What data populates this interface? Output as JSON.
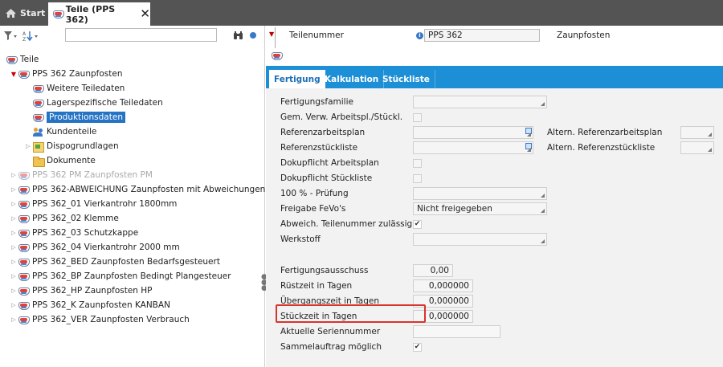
{
  "tabs": {
    "start_label": "Start",
    "active_label": "Teile (PPS 362)",
    "close_glyph": "✕"
  },
  "left_toolbar": {
    "search_value": ""
  },
  "tree": {
    "root_label": "Teile",
    "selected_part": "PPS 362  Zaunpfosten",
    "children": [
      {
        "label": "Weitere Teiledaten",
        "icon": "part-icon"
      },
      {
        "label": "Lagerspezifische Teiledaten",
        "icon": "part-icon"
      },
      {
        "label": "Produktionsdaten",
        "icon": "part-icon",
        "selected": true
      },
      {
        "label": "Kundenteile",
        "icon": "people-icon"
      },
      {
        "label": "Dispogrundlagen",
        "icon": "dispo-icon"
      },
      {
        "label": "Dokumente",
        "icon": "folder-icon"
      }
    ],
    "siblings": [
      {
        "label": "PPS 362 PM  Zaunpfosten PM",
        "disabled": true
      },
      {
        "label": "PPS 362-ABWEICHUNG  Zaunpfosten mit Abweichungen"
      },
      {
        "label": "PPS 362_01  Vierkantrohr 1800mm"
      },
      {
        "label": "PPS 362_02  Klemme"
      },
      {
        "label": "PPS 362_03  Schutzkappe"
      },
      {
        "label": "PPS 362_04  Vierkantrohr 2000 mm"
      },
      {
        "label": "PPS 362_BED  Zaunpfosten Bedarfsgesteuert"
      },
      {
        "label": "PPS 362_BP  Zaunpfosten Bedingt Plangesteuer"
      },
      {
        "label": "PPS 362_HP  Zaunpfosten HP"
      },
      {
        "label": "PPS 362_K  Zaunpfosten KANBAN"
      },
      {
        "label": "PPS 362_VER  Zaunpfosten Verbrauch"
      }
    ]
  },
  "header": {
    "label": "Teilenummer",
    "info_glyph": "i",
    "value": "PPS 362",
    "description": "Zaunpfosten"
  },
  "right_tabs": [
    "Fertigung",
    "Kalkulation",
    "Stückliste"
  ],
  "form": {
    "fertigungsfamilie": {
      "label": "Fertigungsfamilie",
      "value": ""
    },
    "gem_verw": {
      "label": "Gem. Verw. Arbeitspl./Stückl.",
      "checked": false
    },
    "referenzarbeitsplan": {
      "label": "Referenzarbeitsplan",
      "value": ""
    },
    "altern_referenzarbeitsplan": {
      "label": "Altern. Referenzarbeitsplan",
      "value": ""
    },
    "referenzstueckliste": {
      "label": "Referenzstückliste",
      "value": ""
    },
    "altern_referenzstueckliste": {
      "label": "Altern. Referenzstückliste",
      "value": ""
    },
    "dokupflicht_arbeitsplan": {
      "label": "Dokupflicht Arbeitsplan",
      "checked": false
    },
    "dokupflicht_stueckliste": {
      "label": "Dokupflicht Stückliste",
      "checked": false
    },
    "pruefung": {
      "label": "100 % - Prüfung",
      "value": ""
    },
    "freigabe": {
      "label": "Freigabe FeVo's",
      "value": "Nicht freigegeben"
    },
    "abweich": {
      "label": "Abweich. Teilenummer zulässig",
      "checked": true
    },
    "werkstoff": {
      "label": "Werkstoff",
      "value": ""
    },
    "fertigungsausschuss": {
      "label": "Fertigungsausschuss",
      "value": "0,00"
    },
    "ruestzeit": {
      "label": "Rüstzeit in Tagen",
      "value": "0,000000"
    },
    "uebergangszeit": {
      "label": "Übergangszeit in Tagen",
      "value": "0,000000"
    },
    "stueckzeit": {
      "label": "Stückzeit in Tagen",
      "value": "0,000000"
    },
    "seriennummer": {
      "label": "Aktuelle Seriennummer",
      "value": ""
    },
    "sammelauftrag": {
      "label": "Sammelauftrag möglich",
      "checked": true
    }
  },
  "glyphs": {
    "check": "✔",
    "binoculars": "🔭"
  },
  "colors": {
    "tab_bar": "#545454",
    "accent_blue": "#1c8fd6",
    "selection": "#2573c4",
    "highlight_red": "#d9342b"
  }
}
